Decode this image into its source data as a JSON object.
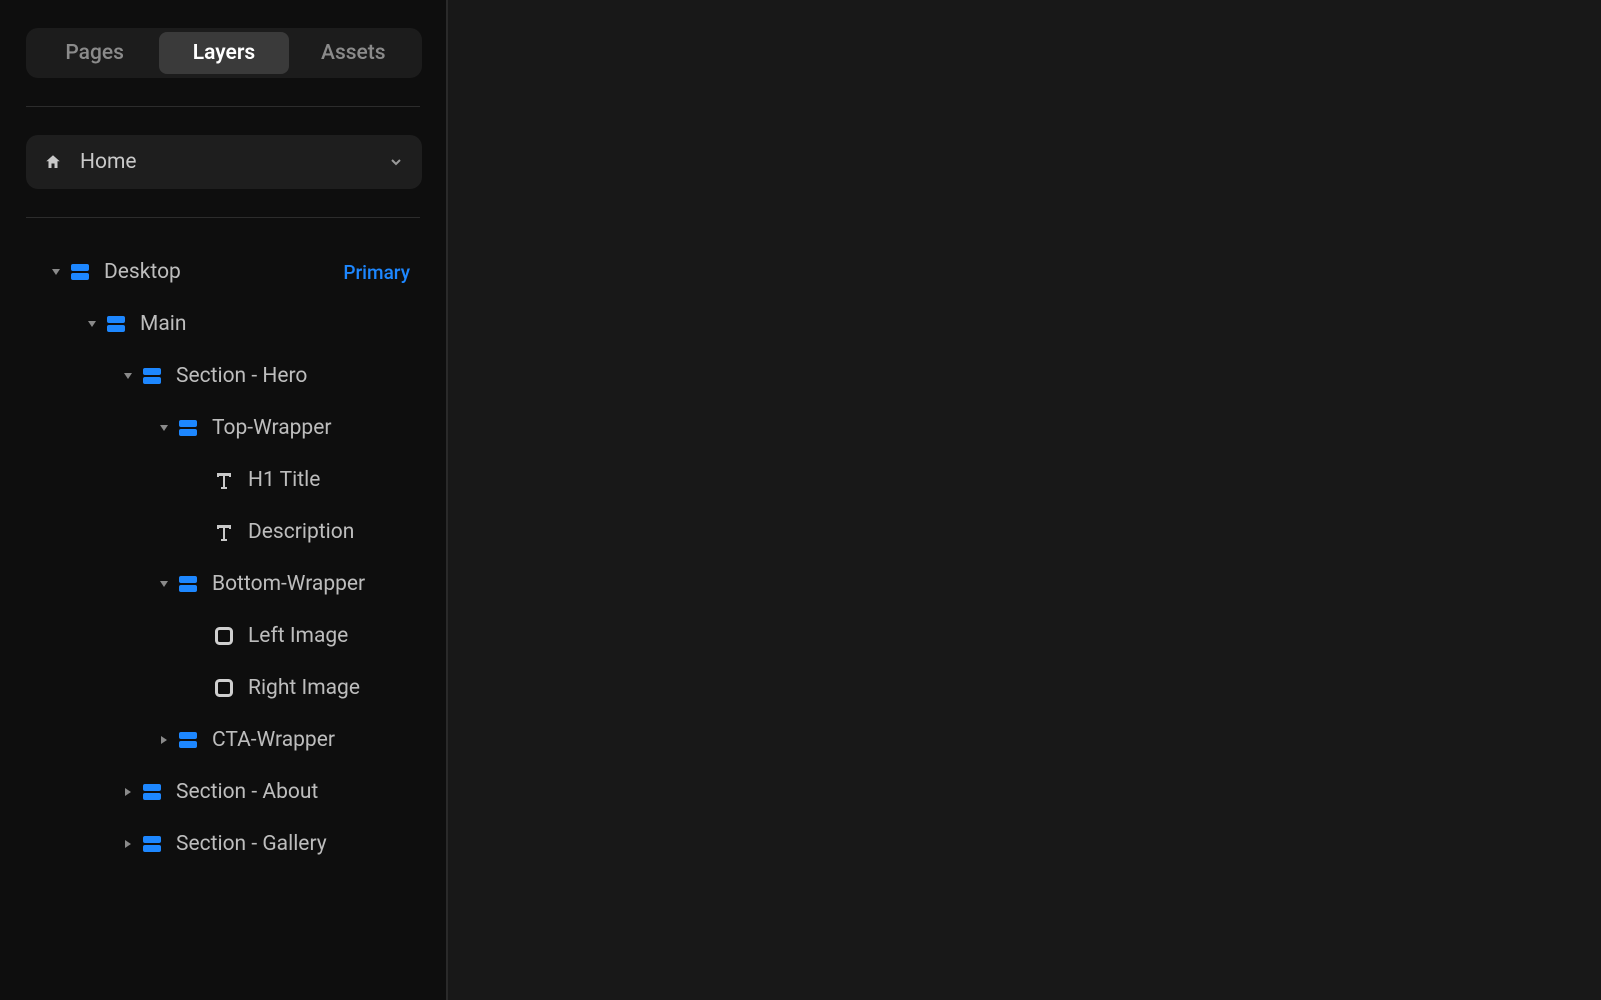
{
  "tabs": {
    "pages": "Pages",
    "layers": "Layers",
    "assets": "Assets",
    "active": "layers"
  },
  "page_selector": {
    "label": "Home"
  },
  "tree": [
    {
      "depth": 0,
      "icon": "stack",
      "label": "Desktop",
      "expanded": true,
      "toggle": "down",
      "badge": "Primary"
    },
    {
      "depth": 1,
      "icon": "stack",
      "label": "Main",
      "expanded": true,
      "toggle": "down"
    },
    {
      "depth": 2,
      "icon": "stack",
      "label": "Section - Hero",
      "expanded": true,
      "toggle": "down"
    },
    {
      "depth": 3,
      "icon": "stack",
      "label": "Top-Wrapper",
      "expanded": true,
      "toggle": "down"
    },
    {
      "depth": 4,
      "icon": "text",
      "label": "H1 Title"
    },
    {
      "depth": 4,
      "icon": "text",
      "label": "Description"
    },
    {
      "depth": 3,
      "icon": "stack",
      "label": "Bottom-Wrapper",
      "expanded": true,
      "toggle": "down"
    },
    {
      "depth": 4,
      "icon": "box",
      "label": "Left Image"
    },
    {
      "depth": 4,
      "icon": "box",
      "label": "Right Image"
    },
    {
      "depth": 3,
      "icon": "stack",
      "label": "CTA-Wrapper",
      "expanded": false,
      "toggle": "right"
    },
    {
      "depth": 2,
      "icon": "stack",
      "label": "Section - About",
      "expanded": false,
      "toggle": "right"
    },
    {
      "depth": 2,
      "icon": "stack",
      "label": "Section - Gallery",
      "expanded": false,
      "toggle": "right"
    }
  ]
}
